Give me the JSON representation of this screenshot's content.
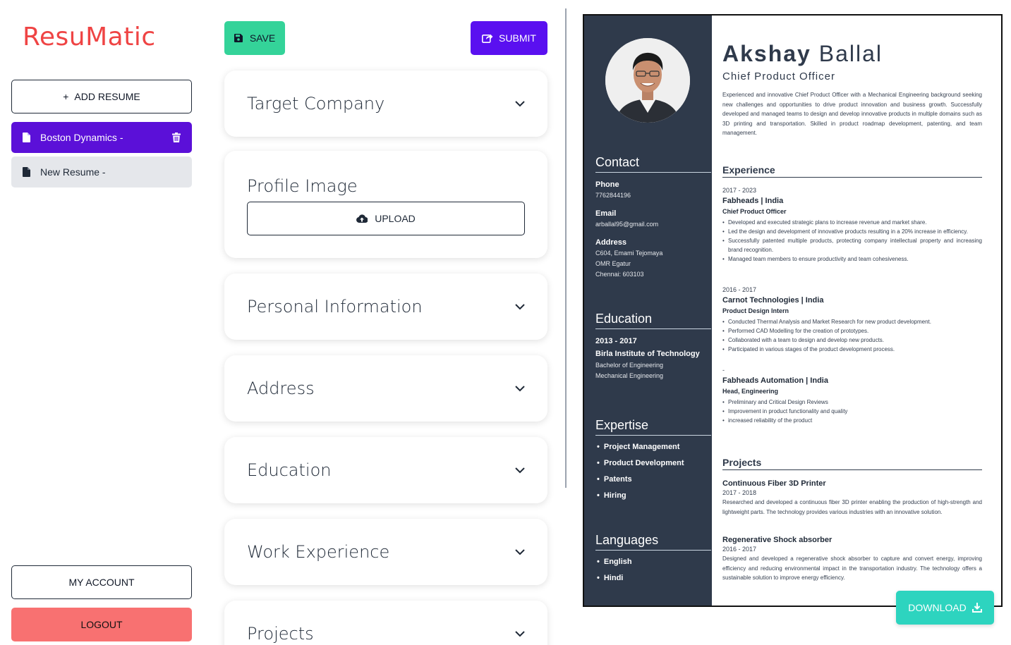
{
  "app": {
    "logo": "ResuMatic"
  },
  "sidebar": {
    "add_resume_label": "ADD RESUME",
    "resumes": [
      {
        "label": "Boston Dynamics -",
        "active": true
      },
      {
        "label": "New Resume -",
        "active": false
      }
    ],
    "my_account_label": "MY ACCOUNT",
    "logout_label": "LOGOUT"
  },
  "form": {
    "save_label": "SAVE",
    "submit_label": "SUBMIT",
    "sections": [
      {
        "title": "Target Company"
      },
      {
        "title": "Profile Image",
        "upload_label": "UPLOAD"
      },
      {
        "title": "Personal Information"
      },
      {
        "title": "Address"
      },
      {
        "title": "Education"
      },
      {
        "title": "Work Experience"
      },
      {
        "title": "Projects"
      }
    ]
  },
  "resume": {
    "first_name": "Akshay",
    "last_name": "Ballal",
    "role": "Chief Product Officer",
    "summary": "Experienced and innovative Chief Product Officer with a Mechanical Engineering background seeking new challenges and opportunities to drive product innovation and business growth. Successfully developed and managed teams to design and develop innovative products in multiple domains such as 3D printing and transportation. Skilled in product roadmap development, patenting, and team management.",
    "contact": {
      "heading": "Contact",
      "phone_label": "Phone",
      "phone": "7762844196",
      "email_label": "Email",
      "email": "arballal95@gmail.com",
      "address_label": "Address",
      "address_line1": "C604, Emami Tejomaya",
      "address_line2": "OMR Egatur",
      "address_line3": "Chennai: 603103"
    },
    "education": {
      "heading": "Education",
      "years": "2013 - 2017",
      "institute": "Birla Institute of Technology",
      "degree": "Bachelor of Engineering",
      "field": "Mechanical Engineering"
    },
    "expertise": {
      "heading": "Expertise",
      "items": [
        "Project Management",
        "Product Development",
        "Patents",
        "Hiring"
      ]
    },
    "languages": {
      "heading": "Languages",
      "items": [
        "English",
        "Hindi"
      ]
    },
    "experience": {
      "heading": "Experience",
      "jobs": [
        {
          "dates": "2017 - 2023",
          "company": "Fabheads | India",
          "title": "Chief Product Officer",
          "bullets": [
            "Developed and executed strategic plans to increase revenue and market share.",
            "Led the design and development of innovative products resulting in a 20% increase in efficiency.",
            "Successfully patented multiple products, protecting company intellectual property and increasing brand recognition.",
            "Managed team members to ensure productivity and team cohesiveness."
          ]
        },
        {
          "dates": "2016 - 2017",
          "company": "Carnot Technologies | India",
          "title": "Product Design Intern",
          "bullets": [
            "Conducted Thermal Analysis and Market Research for new product development.",
            "Performed CAD Modelling for the creation of prototypes.",
            "Collaborated with a team to design and develop new products.",
            "Participated in various stages of the product development process."
          ]
        },
        {
          "dates": "-",
          "company": "Fabheads Automation | India",
          "title": "Head, Engineering",
          "bullets": [
            "Preliminary and Critical Design Reviews",
            "Improvement in product functionality and quality",
            "increased reliability of the product"
          ]
        }
      ]
    },
    "projects": {
      "heading": "Projects",
      "items": [
        {
          "name": "Continuous Fiber 3D Printer",
          "dates": "2017 - 2018",
          "description": "Researched and developed a continuous fiber 3D printer enabling the production of high-strength and lightweight parts. The technology provides various industries with an innovative solution."
        },
        {
          "name": "Regenerative Shock absorber",
          "dates": "2016 - 2017",
          "description": "Designed and developed a regenerative shock absorber to capture and convert energy, improving efficiency and reducing environmental impact in the transportation industry. The technology offers a sustainable solution to improve energy efficiency."
        }
      ]
    },
    "download_label": "DOWNLOAD"
  },
  "icons": {
    "save": "floppy-disk-icon",
    "submit": "share-icon",
    "upload": "cloud-upload-icon",
    "document": "document-icon",
    "trash": "trash-icon",
    "chevron": "chevron-down-icon",
    "download": "download-icon"
  },
  "colors": {
    "logo": "#ef4444",
    "active_resume": "#5b10d8",
    "save": "#34d399",
    "submit": "#5a10f0",
    "logout": "#f87171",
    "download": "#2dd4bf",
    "resume_sidebar": "#2f3a4b"
  }
}
